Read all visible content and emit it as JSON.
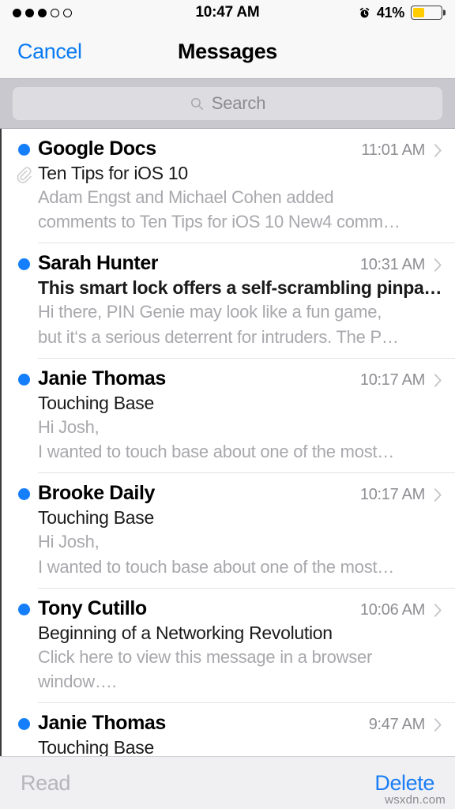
{
  "status_bar": {
    "signal_dots_filled": 3,
    "signal_dots_total": 5,
    "time": "10:47 AM",
    "alarm_icon": "alarm-clock-icon",
    "battery_percent_label": "41%",
    "battery_level": 41,
    "battery_color": "#ffcc00"
  },
  "nav": {
    "cancel_label": "Cancel",
    "title": "Messages"
  },
  "search": {
    "placeholder": "Search",
    "value": "",
    "icon": "search-icon"
  },
  "colors": {
    "accent_blue": "#0a7bf2",
    "unread_dot": "#157efb",
    "time_gray": "#8e8e93",
    "preview_gray": "#a8a8ad",
    "search_bar_bg": "#c8c8ce",
    "toolbar_bg": "#f0f0f2"
  },
  "messages": [
    {
      "unread": true,
      "sender": "Google Docs",
      "time": "11:01 AM",
      "has_attachment": true,
      "subject": "Ten Tips for iOS 10",
      "subject_bold": false,
      "preview_lines": [
        "Adam Engst and Michael Cohen added",
        "comments to Ten Tips for iOS 10 New4 comm…"
      ]
    },
    {
      "unread": true,
      "sender": "Sarah Hunter",
      "time": "10:31 AM",
      "has_attachment": false,
      "subject": "This smart lock offers a self-scrambling pinpa…",
      "subject_bold": true,
      "preview_lines": [
        "Hi there, PIN Genie may look like a fun game,",
        "but it‘s a serious deterrent for intruders. The P…"
      ]
    },
    {
      "unread": true,
      "sender": "Janie Thomas",
      "time": "10:17 AM",
      "has_attachment": false,
      "subject": "Touching Base",
      "subject_bold": false,
      "preview_lines": [
        "Hi Josh,",
        "I wanted to touch base about one of the most…"
      ]
    },
    {
      "unread": true,
      "sender": "Brooke Daily",
      "time": "10:17 AM",
      "has_attachment": false,
      "subject": "Touching Base",
      "subject_bold": false,
      "preview_lines": [
        "Hi Josh,",
        "I wanted to touch base about one of the most…"
      ]
    },
    {
      "unread": true,
      "sender": "Tony Cutillo",
      "time": "10:06 AM",
      "has_attachment": false,
      "subject": "Beginning of a Networking Revolution",
      "subject_bold": false,
      "preview_lines": [
        "Click here to view this message in a browser",
        "window…."
      ]
    },
    {
      "unread": true,
      "sender": "Janie Thomas",
      "time": "9:47 AM",
      "has_attachment": false,
      "subject": "Touching Base",
      "subject_bold": false,
      "preview_lines": []
    }
  ],
  "toolbar": {
    "read_label": "Read",
    "delete_label": "Delete"
  },
  "watermark": "wsxdn.com"
}
